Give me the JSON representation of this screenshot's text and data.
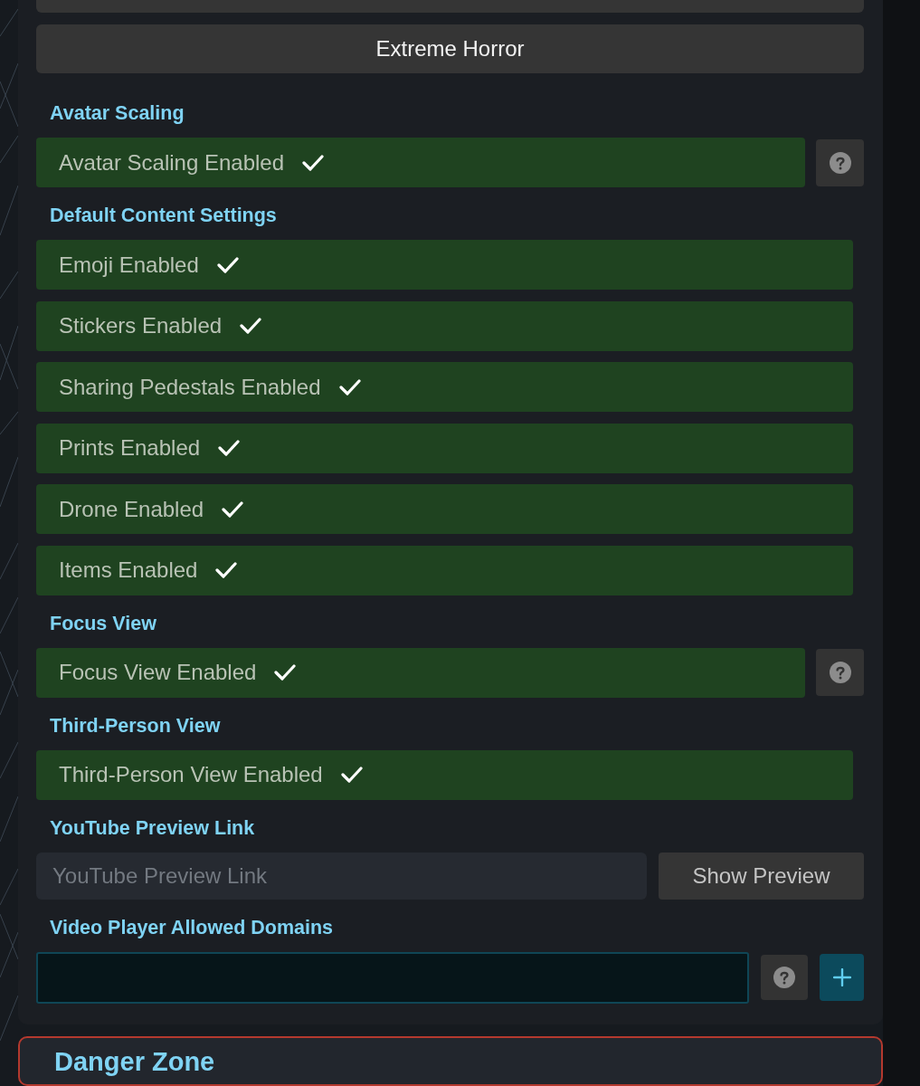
{
  "panel": {
    "buttons": [
      {
        "label": "Extreme Horror"
      }
    ],
    "sections": [
      {
        "kind": "toggles",
        "title": "Avatar Scaling",
        "toggles": [
          {
            "label": "Avatar Scaling Enabled",
            "checked": true,
            "help": true
          }
        ]
      },
      {
        "kind": "toggles",
        "title": "Default Content Settings",
        "toggles": [
          {
            "label": "Emoji Enabled",
            "checked": true,
            "help": false
          },
          {
            "label": "Stickers Enabled",
            "checked": true,
            "help": false
          },
          {
            "label": "Sharing Pedestals Enabled",
            "checked": true,
            "help": false
          },
          {
            "label": "Prints Enabled",
            "checked": true,
            "help": false
          },
          {
            "label": "Drone Enabled",
            "checked": true,
            "help": false
          },
          {
            "label": "Items Enabled",
            "checked": true,
            "help": false
          }
        ]
      },
      {
        "kind": "toggles",
        "title": "Focus View",
        "toggles": [
          {
            "label": "Focus View Enabled",
            "checked": true,
            "help": true
          }
        ]
      },
      {
        "kind": "toggles",
        "title": "Third-Person View",
        "toggles": [
          {
            "label": "Third-Person View Enabled",
            "checked": true,
            "help": false
          }
        ]
      },
      {
        "kind": "preview",
        "title": "YouTube Preview Link",
        "placeholder": "YouTube Preview Link",
        "button": "Show Preview"
      },
      {
        "kind": "domains",
        "title": "Video Player Allowed Domains",
        "help": true
      }
    ]
  },
  "danger_zone": {
    "title": "Danger Zone"
  }
}
